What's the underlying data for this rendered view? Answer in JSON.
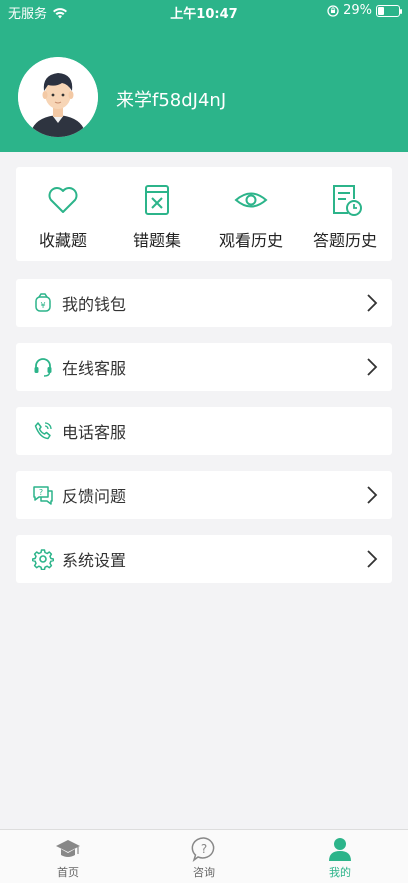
{
  "status_bar": {
    "carrier": "无服务",
    "time": "上午10:47",
    "battery": "29%",
    "battery_level": 0.29
  },
  "profile": {
    "username": "来学f58dJ4nJ"
  },
  "quick_actions": [
    {
      "label": "收藏题",
      "icon": "heart-icon"
    },
    {
      "label": "错题集",
      "icon": "wrong-book-icon"
    },
    {
      "label": "观看历史",
      "icon": "eye-icon"
    },
    {
      "label": "答题历史",
      "icon": "answer-history-icon"
    }
  ],
  "menu": {
    "wallet": {
      "label": "我的钱包",
      "icon": "wallet-icon"
    },
    "online_service": {
      "label": "在线客服",
      "icon": "headset-icon"
    },
    "phone_service": {
      "label": "电话客服",
      "icon": "phone-icon"
    },
    "feedback": {
      "label": "反馈问题",
      "icon": "feedback-icon"
    },
    "settings": {
      "label": "系统设置",
      "icon": "gear-icon"
    }
  },
  "tabbar": [
    {
      "label": "首页",
      "icon": "graduation-cap-icon",
      "active": false
    },
    {
      "label": "咨询",
      "icon": "question-bubble-icon",
      "active": false
    },
    {
      "label": "我的",
      "icon": "person-icon",
      "active": true
    }
  ],
  "colors": {
    "accent": "#2cb48a",
    "background": "#f3f3f5"
  }
}
